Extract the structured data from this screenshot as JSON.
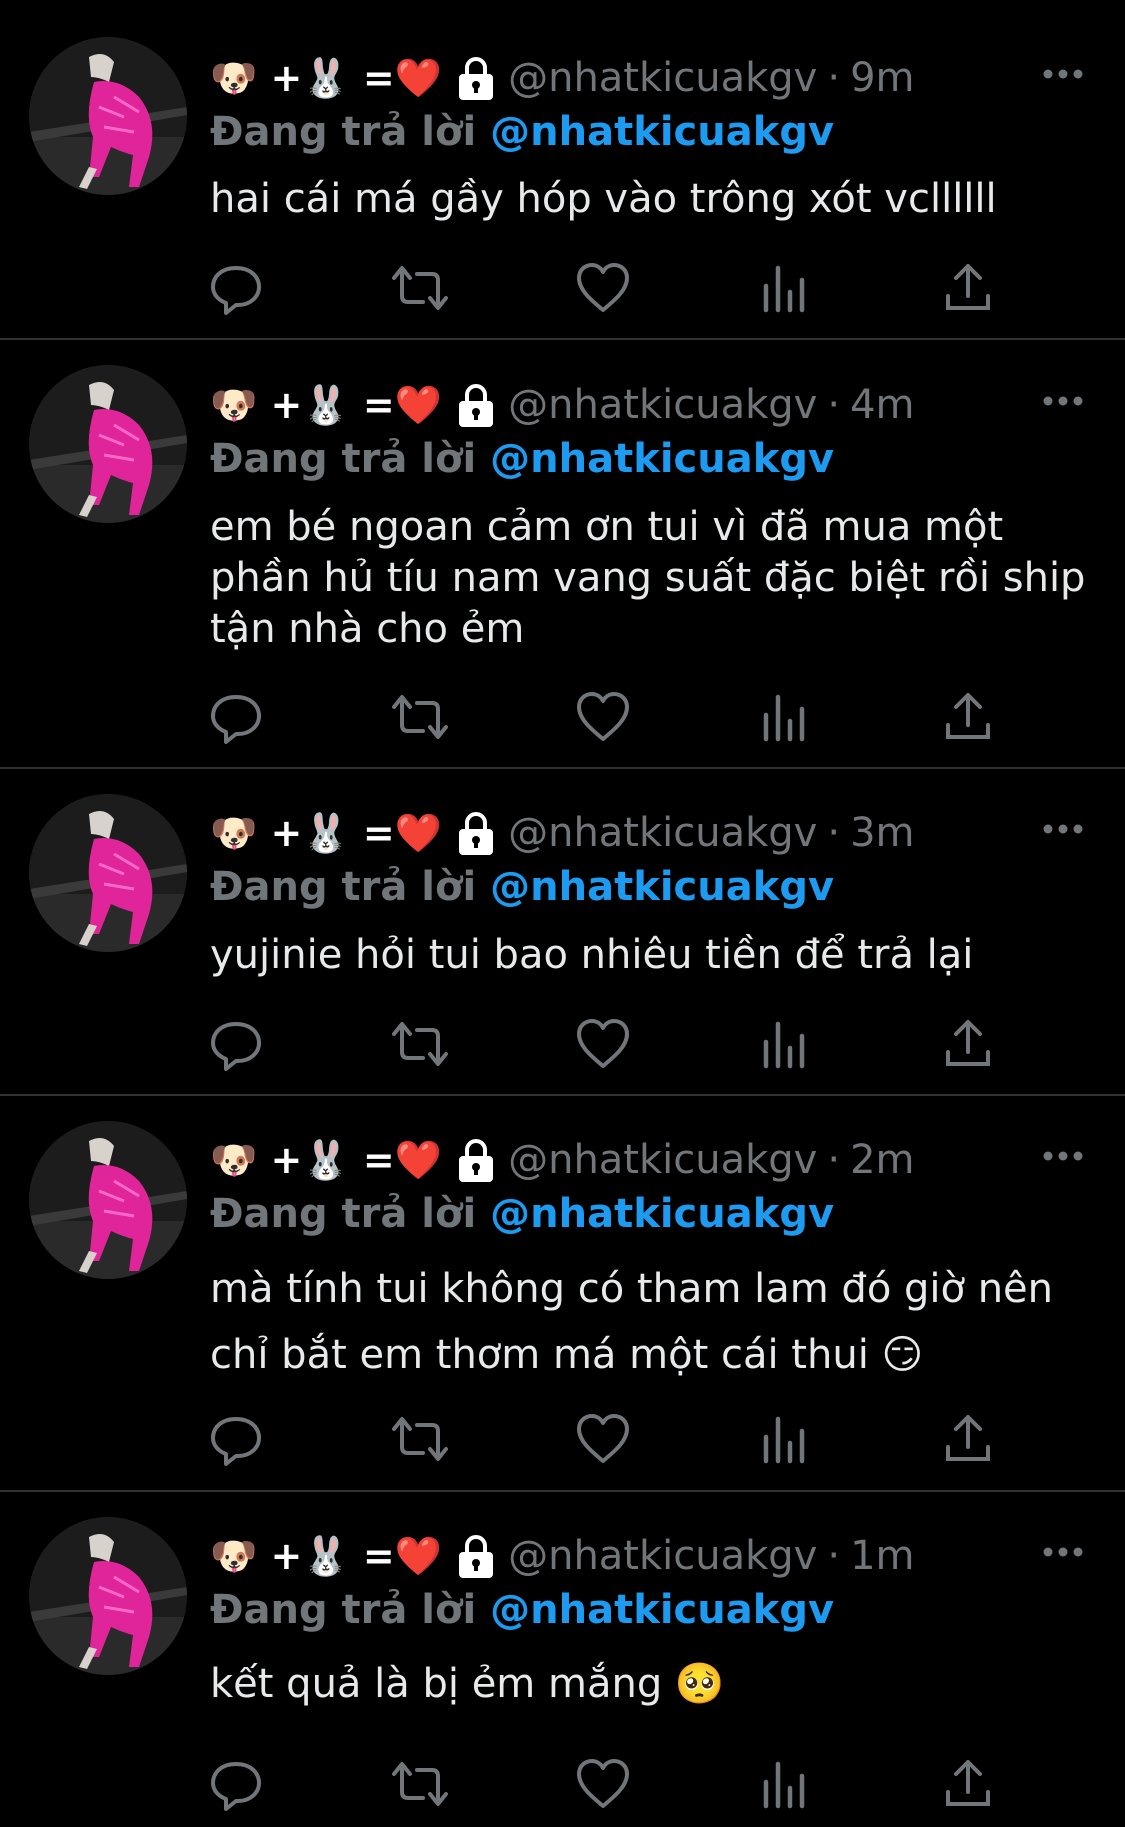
{
  "tweets": [
    {
      "name": "🐶 +🐰 =❤️",
      "handle": "@nhatkicuakgv",
      "dot": "·",
      "time": "9m",
      "reply_prefix": "Đang trả lời",
      "reply_handle": "@nhatkicuakgv",
      "text": "hai cái má gầy hóp vào trông xót vcllllll"
    },
    {
      "name": "🐶 +🐰 =❤️",
      "handle": "@nhatkicuakgv",
      "dot": "·",
      "time": "4m",
      "reply_prefix": "Đang trả lời",
      "reply_handle": "@nhatkicuakgv",
      "text": "em bé ngoan cảm ơn tui vì đã mua một phần hủ tíu nam vang suất đặc biệt rồi ship tận nhà cho ẻm"
    },
    {
      "name": "🐶 +🐰 =❤️",
      "handle": "@nhatkicuakgv",
      "dot": "·",
      "time": "3m",
      "reply_prefix": "Đang trả lời",
      "reply_handle": "@nhatkicuakgv",
      "text": "yujinie hỏi tui bao nhiêu tiền để trả lại"
    },
    {
      "name": "🐶 +🐰 =❤️",
      "handle": "@nhatkicuakgv",
      "dot": "·",
      "time": "2m",
      "reply_prefix": "Đang trả lời",
      "reply_handle": "@nhatkicuakgv",
      "text": "mà tính tui không có tham lam đó giờ nên chỉ bắt em thơm má một cái thui 😏"
    },
    {
      "name": "🐶 +🐰 =❤️",
      "handle": "@nhatkicuakgv",
      "dot": "·",
      "time": "1m",
      "reply_prefix": "Đang trả lời",
      "reply_handle": "@nhatkicuakgv",
      "text": "kết quả là bị ẻm mắng 🥺"
    }
  ],
  "icons": {
    "reply": "reply-icon",
    "retweet": "retweet-icon",
    "like": "heart-icon",
    "views": "views-icon",
    "share": "share-icon",
    "more": "more-icon",
    "lock": "lock-icon"
  },
  "colors": {
    "background": "#000000",
    "text": "#e7e9ea",
    "muted": "#71767b",
    "accent": "#1d9bf0",
    "divider": "#2f3336",
    "avatar_outfit": "#e0249a"
  }
}
